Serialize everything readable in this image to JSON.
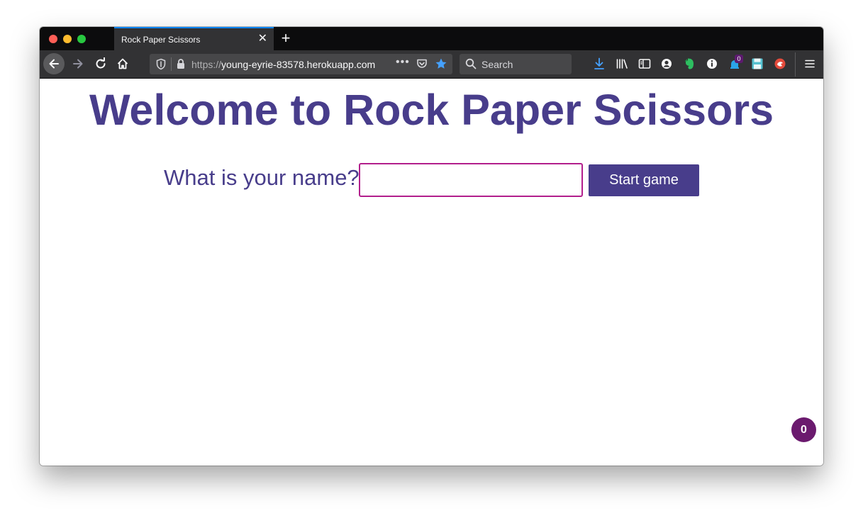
{
  "browser": {
    "tab": {
      "title": "Rock Paper Scissors",
      "close_glyph": "✕"
    },
    "new_tab_glyph": "+",
    "url": {
      "scheme": "https://",
      "host": "young-eyrie-83578.herokuapp.com"
    },
    "url_more_glyph": "•••",
    "search": {
      "placeholder": "Search"
    },
    "extension_badge": "0",
    "colors": {
      "tab_accent": "#0a84ff",
      "star": "#45a1ff",
      "download": "#45a1ff"
    }
  },
  "page": {
    "heading": "Welcome to Rock Paper Scissors",
    "name_label": "What is your name?",
    "name_value": "",
    "start_button": "Start game",
    "counter": "0",
    "colors": {
      "primary": "#483d8b",
      "input_border": "#b21f8c",
      "bubble": "#6b1a6e"
    }
  }
}
